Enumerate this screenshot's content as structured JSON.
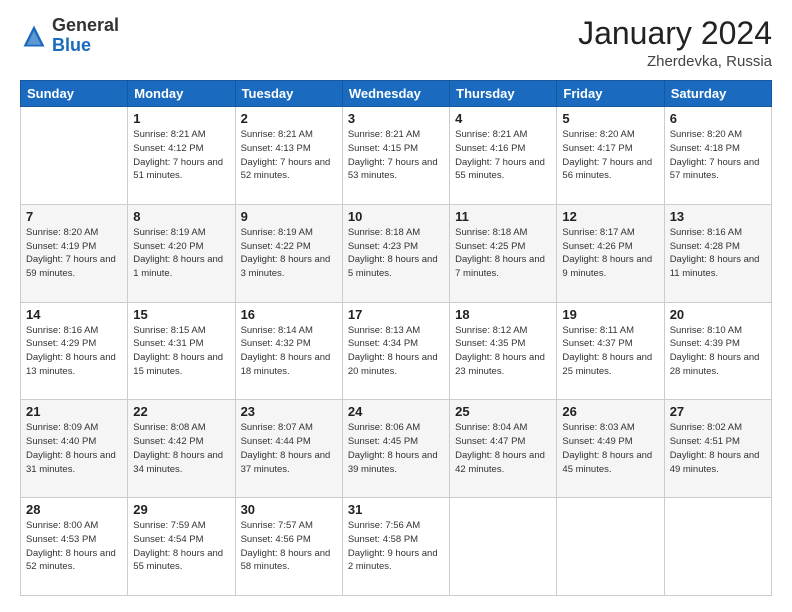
{
  "header": {
    "logo_general": "General",
    "logo_blue": "Blue",
    "month_title": "January 2024",
    "subtitle": "Zherdevka, Russia"
  },
  "days_of_week": [
    "Sunday",
    "Monday",
    "Tuesday",
    "Wednesday",
    "Thursday",
    "Friday",
    "Saturday"
  ],
  "weeks": [
    [
      {
        "day": "",
        "sunrise": "",
        "sunset": "",
        "daylight": ""
      },
      {
        "day": "1",
        "sunrise": "Sunrise: 8:21 AM",
        "sunset": "Sunset: 4:12 PM",
        "daylight": "Daylight: 7 hours and 51 minutes."
      },
      {
        "day": "2",
        "sunrise": "Sunrise: 8:21 AM",
        "sunset": "Sunset: 4:13 PM",
        "daylight": "Daylight: 7 hours and 52 minutes."
      },
      {
        "day": "3",
        "sunrise": "Sunrise: 8:21 AM",
        "sunset": "Sunset: 4:15 PM",
        "daylight": "Daylight: 7 hours and 53 minutes."
      },
      {
        "day": "4",
        "sunrise": "Sunrise: 8:21 AM",
        "sunset": "Sunset: 4:16 PM",
        "daylight": "Daylight: 7 hours and 55 minutes."
      },
      {
        "day": "5",
        "sunrise": "Sunrise: 8:20 AM",
        "sunset": "Sunset: 4:17 PM",
        "daylight": "Daylight: 7 hours and 56 minutes."
      },
      {
        "day": "6",
        "sunrise": "Sunrise: 8:20 AM",
        "sunset": "Sunset: 4:18 PM",
        "daylight": "Daylight: 7 hours and 57 minutes."
      }
    ],
    [
      {
        "day": "7",
        "sunrise": "Sunrise: 8:20 AM",
        "sunset": "Sunset: 4:19 PM",
        "daylight": "Daylight: 7 hours and 59 minutes."
      },
      {
        "day": "8",
        "sunrise": "Sunrise: 8:19 AM",
        "sunset": "Sunset: 4:20 PM",
        "daylight": "Daylight: 8 hours and 1 minute."
      },
      {
        "day": "9",
        "sunrise": "Sunrise: 8:19 AM",
        "sunset": "Sunset: 4:22 PM",
        "daylight": "Daylight: 8 hours and 3 minutes."
      },
      {
        "day": "10",
        "sunrise": "Sunrise: 8:18 AM",
        "sunset": "Sunset: 4:23 PM",
        "daylight": "Daylight: 8 hours and 5 minutes."
      },
      {
        "day": "11",
        "sunrise": "Sunrise: 8:18 AM",
        "sunset": "Sunset: 4:25 PM",
        "daylight": "Daylight: 8 hours and 7 minutes."
      },
      {
        "day": "12",
        "sunrise": "Sunrise: 8:17 AM",
        "sunset": "Sunset: 4:26 PM",
        "daylight": "Daylight: 8 hours and 9 minutes."
      },
      {
        "day": "13",
        "sunrise": "Sunrise: 8:16 AM",
        "sunset": "Sunset: 4:28 PM",
        "daylight": "Daylight: 8 hours and 11 minutes."
      }
    ],
    [
      {
        "day": "14",
        "sunrise": "Sunrise: 8:16 AM",
        "sunset": "Sunset: 4:29 PM",
        "daylight": "Daylight: 8 hours and 13 minutes."
      },
      {
        "day": "15",
        "sunrise": "Sunrise: 8:15 AM",
        "sunset": "Sunset: 4:31 PM",
        "daylight": "Daylight: 8 hours and 15 minutes."
      },
      {
        "day": "16",
        "sunrise": "Sunrise: 8:14 AM",
        "sunset": "Sunset: 4:32 PM",
        "daylight": "Daylight: 8 hours and 18 minutes."
      },
      {
        "day": "17",
        "sunrise": "Sunrise: 8:13 AM",
        "sunset": "Sunset: 4:34 PM",
        "daylight": "Daylight: 8 hours and 20 minutes."
      },
      {
        "day": "18",
        "sunrise": "Sunrise: 8:12 AM",
        "sunset": "Sunset: 4:35 PM",
        "daylight": "Daylight: 8 hours and 23 minutes."
      },
      {
        "day": "19",
        "sunrise": "Sunrise: 8:11 AM",
        "sunset": "Sunset: 4:37 PM",
        "daylight": "Daylight: 8 hours and 25 minutes."
      },
      {
        "day": "20",
        "sunrise": "Sunrise: 8:10 AM",
        "sunset": "Sunset: 4:39 PM",
        "daylight": "Daylight: 8 hours and 28 minutes."
      }
    ],
    [
      {
        "day": "21",
        "sunrise": "Sunrise: 8:09 AM",
        "sunset": "Sunset: 4:40 PM",
        "daylight": "Daylight: 8 hours and 31 minutes."
      },
      {
        "day": "22",
        "sunrise": "Sunrise: 8:08 AM",
        "sunset": "Sunset: 4:42 PM",
        "daylight": "Daylight: 8 hours and 34 minutes."
      },
      {
        "day": "23",
        "sunrise": "Sunrise: 8:07 AM",
        "sunset": "Sunset: 4:44 PM",
        "daylight": "Daylight: 8 hours and 37 minutes."
      },
      {
        "day": "24",
        "sunrise": "Sunrise: 8:06 AM",
        "sunset": "Sunset: 4:45 PM",
        "daylight": "Daylight: 8 hours and 39 minutes."
      },
      {
        "day": "25",
        "sunrise": "Sunrise: 8:04 AM",
        "sunset": "Sunset: 4:47 PM",
        "daylight": "Daylight: 8 hours and 42 minutes."
      },
      {
        "day": "26",
        "sunrise": "Sunrise: 8:03 AM",
        "sunset": "Sunset: 4:49 PM",
        "daylight": "Daylight: 8 hours and 45 minutes."
      },
      {
        "day": "27",
        "sunrise": "Sunrise: 8:02 AM",
        "sunset": "Sunset: 4:51 PM",
        "daylight": "Daylight: 8 hours and 49 minutes."
      }
    ],
    [
      {
        "day": "28",
        "sunrise": "Sunrise: 8:00 AM",
        "sunset": "Sunset: 4:53 PM",
        "daylight": "Daylight: 8 hours and 52 minutes."
      },
      {
        "day": "29",
        "sunrise": "Sunrise: 7:59 AM",
        "sunset": "Sunset: 4:54 PM",
        "daylight": "Daylight: 8 hours and 55 minutes."
      },
      {
        "day": "30",
        "sunrise": "Sunrise: 7:57 AM",
        "sunset": "Sunset: 4:56 PM",
        "daylight": "Daylight: 8 hours and 58 minutes."
      },
      {
        "day": "31",
        "sunrise": "Sunrise: 7:56 AM",
        "sunset": "Sunset: 4:58 PM",
        "daylight": "Daylight: 9 hours and 2 minutes."
      },
      {
        "day": "",
        "sunrise": "",
        "sunset": "",
        "daylight": ""
      },
      {
        "day": "",
        "sunrise": "",
        "sunset": "",
        "daylight": ""
      },
      {
        "day": "",
        "sunrise": "",
        "sunset": "",
        "daylight": ""
      }
    ]
  ]
}
